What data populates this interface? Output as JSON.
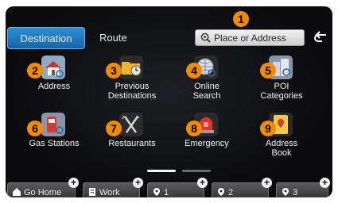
{
  "tabs": {
    "destination": "Destination",
    "route": "Route"
  },
  "search": {
    "placeholder": "Place or Address"
  },
  "grid": [
    {
      "label": "Address",
      "badge": "2"
    },
    {
      "label": "Previous\nDestinations",
      "badge": "3"
    },
    {
      "label": "Online\nSearch",
      "badge": "4"
    },
    {
      "label": "POI\nCategories",
      "badge": "5"
    },
    {
      "label": "Gas Stations",
      "badge": "6"
    },
    {
      "label": "Restaurants",
      "badge": "7"
    },
    {
      "label": "Emergency",
      "badge": "8"
    },
    {
      "label": "Address\nBook",
      "badge": "9"
    }
  ],
  "search_badge": "1",
  "favorites": [
    {
      "label": "Go Home",
      "icon": "home-icon"
    },
    {
      "label": "Work",
      "icon": "building-icon"
    },
    {
      "label": "1",
      "icon": "favorite-pin-icon"
    },
    {
      "label": "2",
      "icon": "favorite-pin-icon"
    },
    {
      "label": "3",
      "icon": "favorite-pin-icon"
    }
  ],
  "colors": {
    "accent_tab": "#1f7cc4",
    "badge": "#f28b00",
    "background": "#0e0e10"
  }
}
